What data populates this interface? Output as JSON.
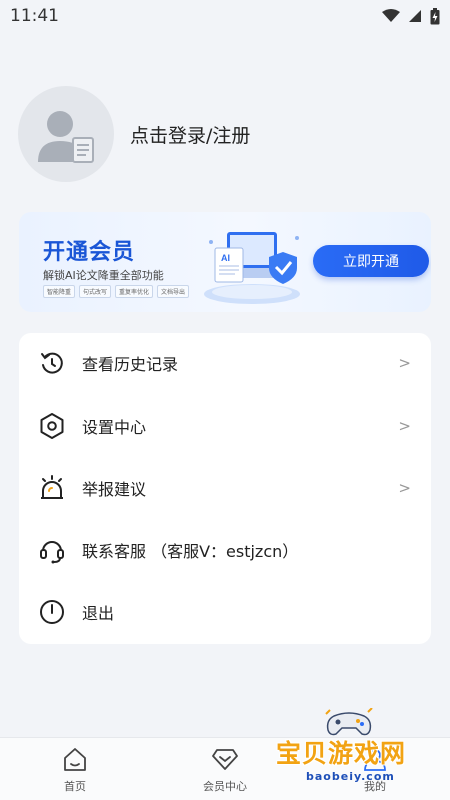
{
  "status_bar": {
    "time": "11:41"
  },
  "profile": {
    "login_label": "点击登录/注册"
  },
  "banner": {
    "title": "开通会员",
    "subtitle": "解锁AI论文降重全部功能",
    "tags": [
      "智能降重",
      "句式改写",
      "重复率优化",
      "文档导出"
    ],
    "button_label": "立即开通",
    "ai_label": "AI"
  },
  "menu": {
    "items": [
      {
        "label": "查看历史记录",
        "icon": "history-icon",
        "arrow": ">"
      },
      {
        "label": "设置中心",
        "icon": "settings-icon",
        "arrow": ">"
      },
      {
        "label": "举报建议",
        "icon": "alarm-icon",
        "arrow": ">"
      },
      {
        "label": "联系客服 （客服V：estjzcn）",
        "icon": "headset-icon",
        "arrow": ""
      },
      {
        "label": "退出",
        "icon": "power-icon",
        "arrow": ""
      }
    ]
  },
  "bottom_nav": {
    "items": [
      {
        "label": "首页",
        "icon": "home-icon"
      },
      {
        "label": "会员中心",
        "icon": "diamond-icon"
      },
      {
        "label": "我的",
        "icon": "profile-icon"
      }
    ]
  },
  "watermark": {
    "text": "宝贝游戏网",
    "url": "baobeiy.com"
  },
  "colors": {
    "accent": "#1f5ae8",
    "background": "#f2f4f8",
    "watermark": "#f2a313"
  }
}
